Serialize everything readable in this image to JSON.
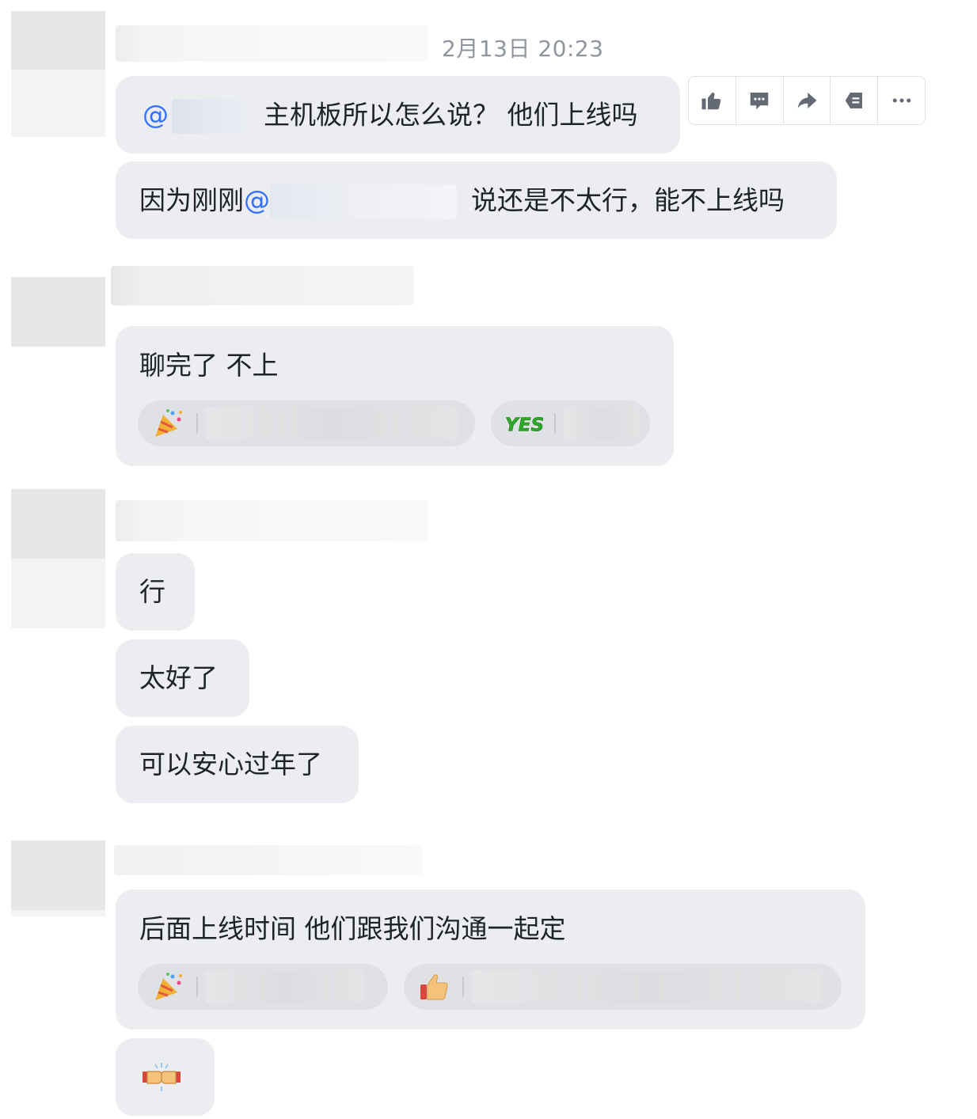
{
  "chat": {
    "timestamp": "2月13日 20:23",
    "messages": [
      {
        "mention_prefix": "@",
        "text": "主机板所以怎么说？ 他们上线吗"
      },
      {
        "before": "因为刚刚",
        "mention_prefix": "@",
        "after": "说还是不太行，能不上线吗"
      },
      {
        "text": "聊完了 不上"
      },
      {
        "text": "行"
      },
      {
        "text": "太好了"
      },
      {
        "text": "可以安心过年了"
      },
      {
        "text": "后面上线时间 他们跟我们沟通一起定"
      }
    ],
    "reactions": {
      "yes_label": "YES"
    }
  },
  "toolbar": {
    "icons": [
      "thumbs-up-icon",
      "reply-icon",
      "forward-icon",
      "pin-icon",
      "more-icon"
    ]
  },
  "colors": {
    "bubble": "#ebedf0",
    "mention": "#3370ff",
    "timestamp": "#8f959e",
    "yes_green": "#2ea82a"
  }
}
